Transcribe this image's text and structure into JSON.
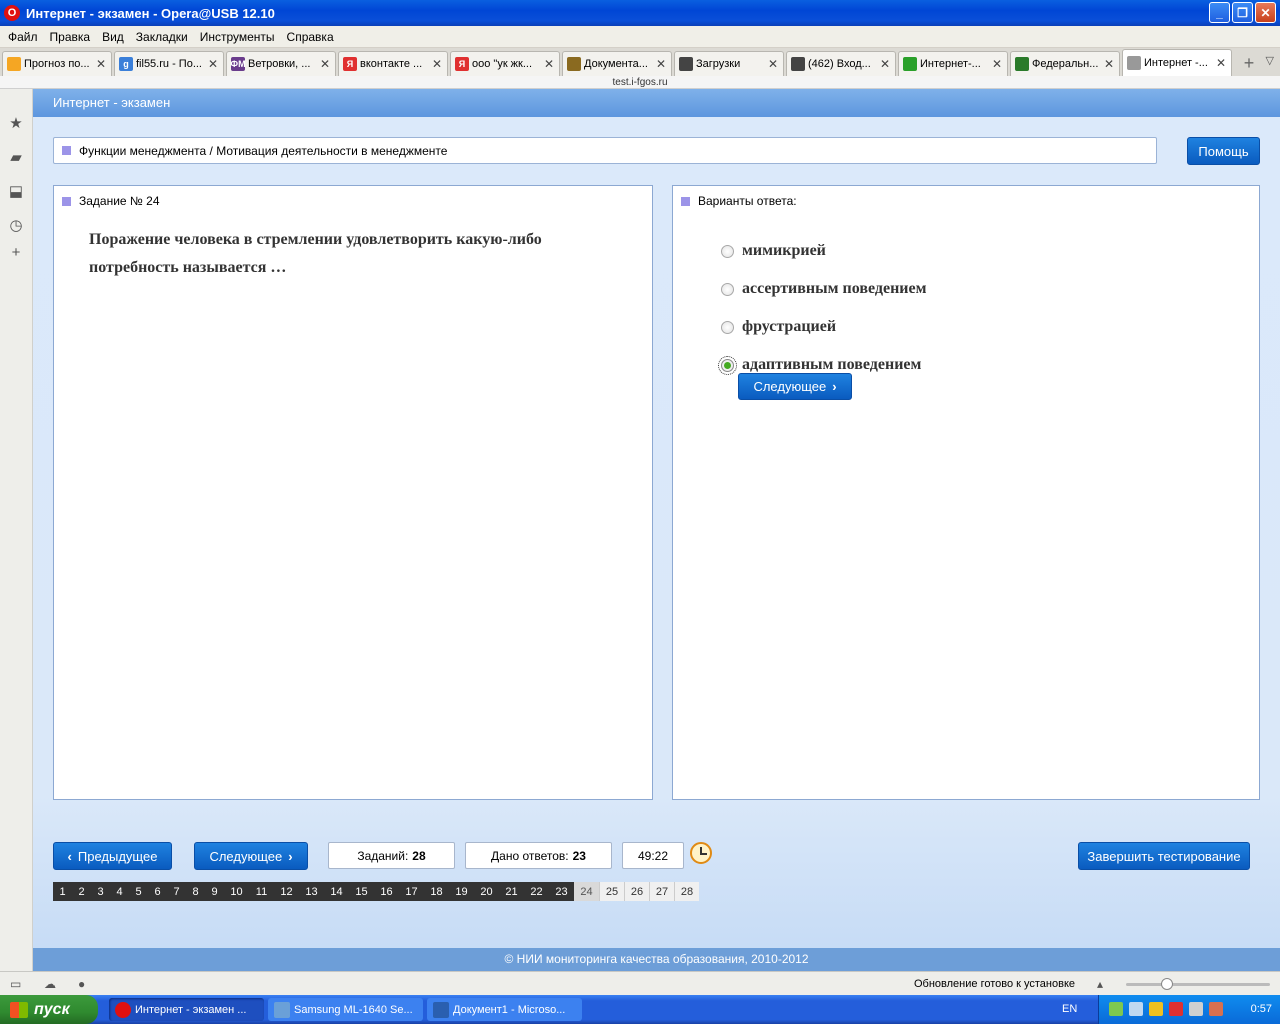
{
  "window": {
    "title": "Интернет - экзамен - Opera@USB 12.10",
    "opera_logo": "O"
  },
  "menu": [
    "Файл",
    "Правка",
    "Вид",
    "Закладки",
    "Инструменты",
    "Справка"
  ],
  "tabs": [
    {
      "label": "Прогноз по...",
      "color": "#f5a623"
    },
    {
      "label": "fil55.ru - По...",
      "color": "#3b7fd9",
      "glyph": "g"
    },
    {
      "label": "Ветровки, ...",
      "color": "#6a3c8c",
      "glyph": "ФМ"
    },
    {
      "label": "вконтакте ...",
      "color": "#e03030",
      "glyph": "Я"
    },
    {
      "label": "ооо \"ук жк...",
      "color": "#e03030",
      "glyph": "Я"
    },
    {
      "label": "Документа...",
      "color": "#8a6a20"
    },
    {
      "label": "Загрузки",
      "color": "#444"
    },
    {
      "label": "(462) Вход...",
      "color": "#444"
    },
    {
      "label": "Интернет-...",
      "color": "#2aa02a"
    },
    {
      "label": "Федеральн...",
      "color": "#2a7a2a"
    },
    {
      "label": "Интернет -...",
      "color": "#999",
      "active": true
    }
  ],
  "address": "test.i-fgos.ru",
  "page": {
    "header": "Интернет - экзамен",
    "breadcrumb": "Функции менеджмента / Мотивация деятельности в менеджменте",
    "help_label": "Помощь",
    "task_title": "Задание № 24",
    "question": "Поражение человека в стремлении удовлетворить какую-либо потребность называется …",
    "answers_title": "Варианты ответа:",
    "answers": [
      {
        "label": "мимикрией",
        "checked": false
      },
      {
        "label": "ассертивным поведением",
        "checked": false
      },
      {
        "label": "фрустрацией",
        "checked": false
      },
      {
        "label": "адаптивным поведением",
        "checked": true
      }
    ],
    "next_inline_label": "Следующее",
    "prev_label": "Предыдущее",
    "next_label": "Следующее",
    "tasks_label": "Заданий:",
    "tasks_count": "28",
    "answered_label": "Дано ответов:",
    "answered_count": "23",
    "timer": "49:22",
    "finish_label": "Завершить тестирование",
    "pages": [
      "1",
      "2",
      "3",
      "4",
      "5",
      "6",
      "7",
      "8",
      "9",
      "10",
      "11",
      "12",
      "13",
      "14",
      "15",
      "16",
      "17",
      "18",
      "19",
      "20",
      "21",
      "22",
      "23",
      "24",
      "25",
      "26",
      "27",
      "28"
    ],
    "current_page": 24,
    "copyright": "© НИИ мониторинга качества образования, 2010-2012"
  },
  "statusbar": {
    "update_text": "Обновление готово к установке"
  },
  "taskbar": {
    "start_label": "пуск",
    "tasks": [
      {
        "label": "Интернет - экзамен ...",
        "active": true,
        "color": "#e01010"
      },
      {
        "label": "Samsung ML-1640 Se...",
        "active": false,
        "color": "#6aa0d8"
      },
      {
        "label": "Документ1 - Microso...",
        "active": false,
        "color": "#2a5fb0"
      }
    ],
    "lang": "EN",
    "clock": "0:57"
  }
}
